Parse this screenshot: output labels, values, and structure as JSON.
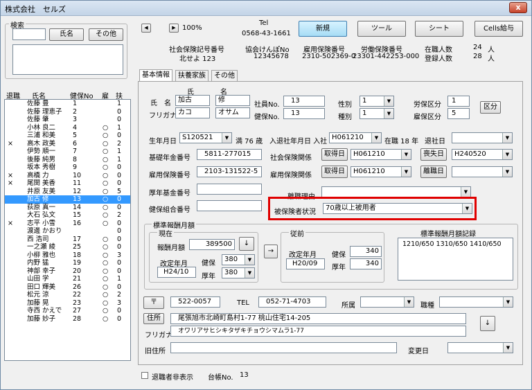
{
  "window": {
    "title": "株式会社　セルズ",
    "close": "x"
  },
  "search": {
    "legend": "検索",
    "name_btn": "氏名",
    "other_btn": "その他"
  },
  "list": {
    "headers": [
      "退職",
      "氏名",
      "健保No",
      "雇",
      "扶"
    ],
    "rows": [
      [
        "",
        "佐藤 豊",
        "1",
        "",
        "1"
      ],
      [
        "",
        "佐藤 理恵子",
        "2",
        "",
        "0"
      ],
      [
        "",
        "佐藤 肇",
        "3",
        "",
        "0"
      ],
      [
        "",
        "小林 良二",
        "4",
        "○",
        "1"
      ],
      [
        "",
        "三浦 和美",
        "5",
        "○",
        "0"
      ],
      [
        "×",
        "高木 政美",
        "6",
        "○",
        "2"
      ],
      [
        "",
        "伊勢 順一",
        "7",
        "○",
        "1"
      ],
      [
        "",
        "後藤 純男",
        "8",
        "○",
        "1"
      ],
      [
        "",
        "坂本 秀樹",
        "9",
        "○",
        "0"
      ],
      [
        "×",
        "高橋 力",
        "10",
        "○",
        "0"
      ],
      [
        "×",
        "尾関 美香",
        "11",
        "○",
        "0"
      ],
      [
        "",
        "井原 友美",
        "12",
        "○",
        "5"
      ],
      [
        "",
        "加古 修",
        "13",
        "○",
        "0"
      ],
      [
        "",
        "荻原 真一",
        "14",
        "○",
        "0"
      ],
      [
        "",
        "大石 弘文",
        "15",
        "○",
        "2"
      ],
      [
        "×",
        "志平 小雪",
        "16",
        "○",
        "0"
      ],
      [
        "",
        "渡邊 かおり",
        "",
        "",
        "0"
      ],
      [
        "",
        "西 浩司",
        "17",
        "○",
        "0"
      ],
      [
        "",
        "一之瀬 綾",
        "25",
        "○",
        "0"
      ],
      [
        "",
        "小柳 雅也",
        "18",
        "○",
        "3"
      ],
      [
        "",
        "内野 猛",
        "19",
        "○",
        "0"
      ],
      [
        "",
        "神部 幸子",
        "20",
        "○",
        "0"
      ],
      [
        "",
        "山田 学",
        "21",
        "○",
        "1"
      ],
      [
        "",
        "田口 輝美",
        "26",
        "○",
        "0"
      ],
      [
        "",
        "松元 涼",
        "22",
        "○",
        "2"
      ],
      [
        "",
        "加藤 晃",
        "23",
        "○",
        "3"
      ],
      [
        "",
        "寺西 かえで",
        "27",
        "○",
        "0"
      ],
      [
        "",
        "加藤 妙子",
        "28",
        "○",
        "0"
      ]
    ],
    "selected_index": 12
  },
  "toolbar": {
    "zoom": "100%",
    "tel_label": "Tel",
    "tel": "0568-43-1661",
    "new": "新規",
    "tool": "ツール",
    "sheet": "シート",
    "cells": "Cells給与"
  },
  "summary": {
    "shaho_label": "社会保険記号番号",
    "shaho": "北せよ 123",
    "kyokai_label": "協会けんぽNo",
    "kyokai": "12345678",
    "koyo_label": "雇用保険番号",
    "koyo": "2310-502369-0",
    "rodo_label": "労働保険番号",
    "rodo": "23301-442253-000",
    "zaishoku_label": "在職人数",
    "zaishoku": "24",
    "toroku_label": "登録人数",
    "toroku": "28",
    "nin": "人"
  },
  "tabs": [
    "基本情報",
    "扶養家族",
    "その他"
  ],
  "basic": {
    "shi": "氏",
    "mei": "名",
    "shimei": "氏　名",
    "furigana": "フリガナ",
    "sei_val": "加古",
    "mei_val": "修",
    "kana_sei": "カコ",
    "kana_mei": "オサム",
    "shain_label": "社員No.",
    "shain": "13",
    "kenpo_label": "健保No.",
    "kenpo": "13",
    "seibetsu_label": "性別",
    "seibetsu": "1",
    "shubetsu_label": "種別",
    "shubetsu": "1",
    "rosai_label": "労保区分",
    "rosai": "1",
    "koyo_kubun_label": "雇保区分",
    "koyo_kubun": "5",
    "kubun_btn": "区分"
  },
  "dates": {
    "birth_label": "生年月日",
    "birth": "S120521",
    "age": "満 76 歳",
    "nyusha_label": "入退社年月日 入社",
    "nyusha": "H061210",
    "zaishoku": "在職 18 年",
    "taisha_label": "退社日",
    "taisha": "",
    "kiso_label": "基礎年金番号",
    "kiso": "5811-277015",
    "shakai_label": "社会保険関係",
    "shutoku_btn": "取得日",
    "shakai_date": "H061210",
    "soshitsu_btn": "喪失日",
    "soshitsu_date": "H240520",
    "koyo_no_label": "雇用保険番号",
    "koyo_no": "2103-131522-5",
    "koyo_rel_label": "雇用保険関係",
    "shutoku2_btn": "取得日",
    "koyo_date": "H061210",
    "rishoku_btn": "離職日",
    "rishoku_date": "",
    "kosei_label": "厚年基金番号",
    "kosei": "",
    "rishoku_riyu_label": "離職理由",
    "rishoku_riyu": "",
    "kenpo_kumiai_label": "健保組合番号",
    "kenpo_kumiai": "",
    "hihoken_label": "被保険者状況",
    "hihoken": "70歳以上被用者"
  },
  "hoshu": {
    "legend": "標準報酬月額",
    "genzai": "現在",
    "hoshu_label": "報酬月額",
    "hoshu": "389500",
    "arrow_down": "↓",
    "kaitei_label": "改定年月",
    "kaitei": "H24/10",
    "kenpo_label": "健保",
    "kenpo": "380",
    "kosei_label": "厚年",
    "kosei": "380",
    "arrow_right": "→",
    "juzen": "従前",
    "juzen_kaitei_label": "改定年月",
    "juzen_kaitei": "H20/09",
    "juzen_kenpo_label": "健保",
    "juzen_kenpo": "340",
    "juzen_kosei_label": "厚年",
    "juzen_kosei": "340",
    "kiroku_label": "標準報酬月額記録",
    "kiroku": "1210/650 1310/650 1410/650"
  },
  "address": {
    "zip_btn": "〒",
    "zip": "522-0057",
    "tel_label": "TEL",
    "tel": "052-71-4703",
    "shozoku_label": "所属",
    "shozoku": "",
    "shokushu_label": "職種",
    "shokushu": "",
    "jusho_btn": "住所",
    "jusho": "尾張旭市北崎町島村1-77 桃山住宅14-205",
    "kana_label": "フリガナ",
    "kana": "オワリアサヒシキタザキチョウシマムラ1-77",
    "arrow_down": "↓",
    "kyu_label": "旧住所",
    "kyu": "",
    "henko_label": "変更日",
    "henko": ""
  },
  "footer": {
    "taishoku_hidden": "退職者非表示",
    "daicho_label": "台帳No.",
    "daicho": "13"
  }
}
